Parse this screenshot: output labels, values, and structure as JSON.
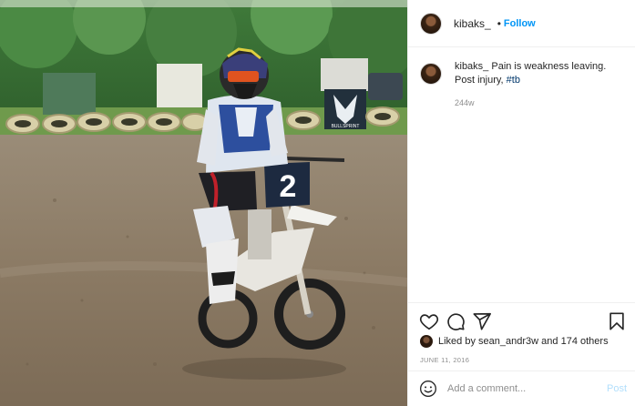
{
  "photo": {
    "alt_subject": "motocross-rider",
    "bib_number": "2",
    "banner_text": "BULLSPRINT"
  },
  "header": {
    "username": "kibaks_",
    "separator": "•",
    "follow_label": "Follow"
  },
  "caption": {
    "username": "kibaks_",
    "text": "Pain is weakness leaving. Post injury, ",
    "hashtag": "#tb",
    "time_ago": "244w"
  },
  "actions": {
    "icons": [
      "heart-icon",
      "comment-icon",
      "share-icon",
      "bookmark-icon"
    ]
  },
  "likes": {
    "prefix": "Liked by ",
    "user": "sean_andr3w",
    "middle": " and ",
    "others": "174 others"
  },
  "date": "JUNE 11, 2016",
  "comment": {
    "placeholder": "Add a comment...",
    "post_label": "Post"
  },
  "colors": {
    "link_blue": "#0095f6",
    "hashtag": "#00376b",
    "muted": "#8e8e8e",
    "post_disabled": "#b2dffc"
  }
}
